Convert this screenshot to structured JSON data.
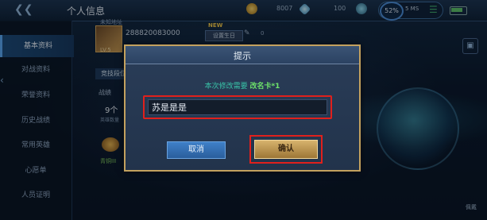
{
  "topbar": {
    "title": "个人信息",
    "resources": [
      {
        "icon": "gold-coin-icon",
        "value": "8007",
        "color": "#c9982f"
      },
      {
        "icon": "diamond-icon",
        "value": "100",
        "color": "#7ec4e8"
      },
      {
        "icon": "crystal-icon",
        "value": "",
        "color": "#4c9bc0"
      }
    ],
    "status": {
      "battery_pct": "52%",
      "latency": "5 MS"
    }
  },
  "sidebar": {
    "items": [
      {
        "label": "基本资料",
        "active": true
      },
      {
        "label": "对战资料",
        "active": false
      },
      {
        "label": "荣誉资料",
        "active": false
      },
      {
        "label": "历史战绩",
        "active": false
      },
      {
        "label": "常用英雄",
        "active": false
      },
      {
        "label": "心愿单",
        "active": false
      },
      {
        "label": "人员证明",
        "active": false
      }
    ]
  },
  "profile": {
    "location": "未知地址",
    "uid": "288820083000",
    "level": "LV.5",
    "new_badge": "NEW",
    "birthday_label": "设置生日",
    "count": "0",
    "tab": "竞技段位",
    "stat_label": "战绩",
    "stat_value": "9个",
    "stat_sub": "英雄数量",
    "mini_label": "青铜III"
  },
  "bottom_right_label": "佩戴",
  "dialog": {
    "title": "提示",
    "message_prefix": "本次修改需要",
    "message_highlight": "改名卡*1",
    "input_value": "苏是是是",
    "cancel_label": "取消",
    "confirm_label": "确认"
  }
}
